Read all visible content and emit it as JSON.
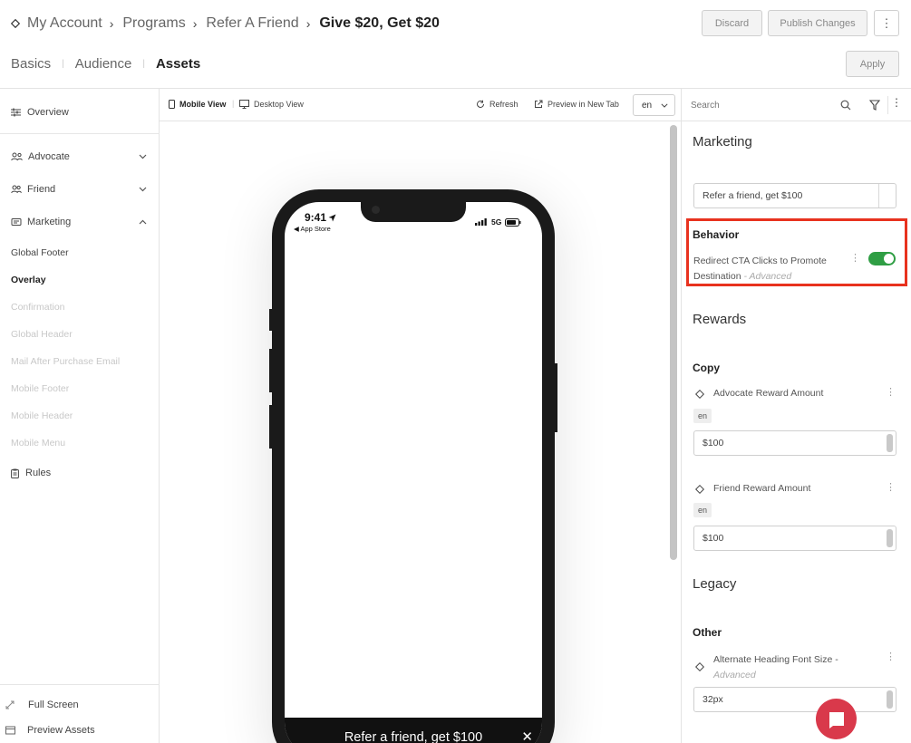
{
  "breadcrumb": {
    "items": [
      "My Account",
      "Programs",
      "Refer A Friend"
    ],
    "current": "Give $20, Get $20"
  },
  "header": {
    "discard": "Discard",
    "publish": "Publish Changes",
    "apply": "Apply",
    "more": "⋮"
  },
  "tabs": [
    "Basics",
    "Audience",
    "Assets"
  ],
  "sidebar": {
    "overview": "Overview",
    "groups": [
      "Advocate",
      "Friend",
      "Marketing"
    ],
    "marketing_items": [
      "Global Footer",
      "Overlay",
      "Confirmation",
      "Global Header",
      "Mail After Purchase Email",
      "Mobile Footer",
      "Mobile Header",
      "Mobile Menu"
    ],
    "rules": "Rules",
    "full_screen": "Full Screen",
    "preview_assets": "Preview Assets"
  },
  "preview_toolbar": {
    "mobile": "Mobile View",
    "desktop": "Desktop View",
    "refresh": "Refresh",
    "preview_tab": "Preview in New Tab",
    "lang": "en"
  },
  "phone": {
    "time": "9:41",
    "back": "◀ App Store",
    "network": "5G",
    "cta": "Refer a friend, get $100",
    "close": "✕"
  },
  "right": {
    "search_placeholder": "Search",
    "marketing_heading": "Marketing",
    "marketing_value": "Refer a friend, get $100",
    "behavior_heading": "Behavior",
    "behavior_label": "Redirect CTA Clicks to Promote",
    "behavior_label2": "Destination",
    "behavior_advanced": "- Advanced",
    "rewards_heading": "Rewards",
    "copy_heading": "Copy",
    "advocate_label": "Advocate Reward Amount",
    "advocate_lang": "en",
    "advocate_value": "$100",
    "friend_label": "Friend Reward Amount",
    "friend_lang": "en",
    "friend_value": "$100",
    "legacy_heading": "Legacy",
    "other_heading": "Other",
    "alt_label": "Alternate Heading Font Size -",
    "alt_advanced": "Advanced",
    "alt_value": "32px"
  },
  "colors": {
    "toggle_on": "#2f9e44",
    "highlight": "#e8321e",
    "chat": "#d9394b"
  }
}
